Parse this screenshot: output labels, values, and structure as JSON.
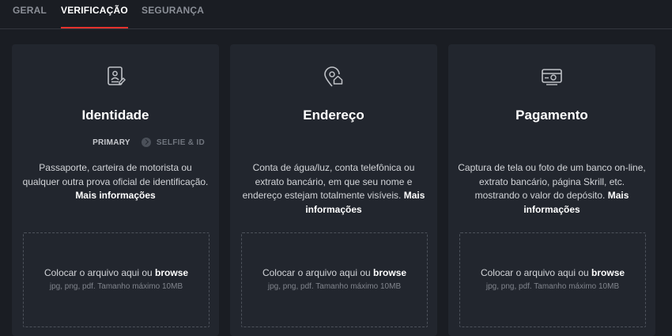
{
  "tabs": [
    {
      "label": "GERAL",
      "active": false
    },
    {
      "label": "VERIFICAÇÃO",
      "active": true
    },
    {
      "label": "SEGURANÇA",
      "active": false
    }
  ],
  "accent_color": "#e5322d",
  "cards": [
    {
      "icon": "id-document-icon",
      "title": "Identidade",
      "steps": {
        "primary": "PRIMARY",
        "secondary": "SELFIE & ID"
      },
      "description": "Passaporte, carteira de motorista ou qualquer outra prova oficial de identificação.",
      "more": "Mais informações",
      "upload_text": "Colocar o arquivo aqui ou",
      "upload_link": "browse",
      "upload_hint": "jpg, png, pdf. Tamanho máximo 10MB"
    },
    {
      "icon": "address-location-icon",
      "title": "Endereço",
      "description": "Conta de água/luz, conta telefônica ou extrato bancário, em que seu nome e endereço estejam totalmente visíveis.",
      "more": "Mais informações",
      "upload_text": "Colocar o arquivo aqui ou",
      "upload_link": "browse",
      "upload_hint": "jpg, png, pdf. Tamanho máximo 10MB"
    },
    {
      "icon": "payment-card-icon",
      "title": "Pagamento",
      "description": "Captura de tela ou foto de um banco on-line, extrato bancário, página Skrill, etc. mostrando o valor do depósito.",
      "more": "Mais informações",
      "upload_text": "Colocar o arquivo aqui ou",
      "upload_link": "browse",
      "upload_hint": "jpg, png, pdf. Tamanho máximo 10MB"
    }
  ]
}
